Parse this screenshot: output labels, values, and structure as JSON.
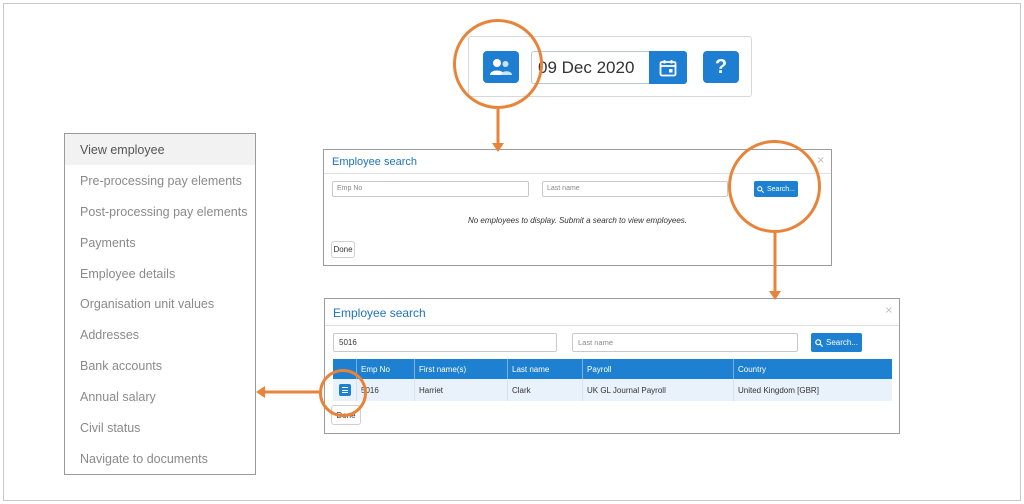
{
  "toolbar": {
    "date_value": "09 Dec 2020",
    "help_label": "?",
    "icons": [
      "employee-search-icon",
      "calendar-icon"
    ]
  },
  "menu": {
    "items": [
      "View employee",
      "Pre-processing pay elements",
      "Post-processing pay elements",
      "Payments",
      "Employee details",
      "Organisation unit values",
      "Addresses",
      "Bank accounts",
      "Annual salary",
      "Civil status",
      "Navigate to documents"
    ]
  },
  "dialog1": {
    "title": "Employee search",
    "emp_no_placeholder": "Emp No",
    "last_name_placeholder": "Last name",
    "search_label": "Search...",
    "empty_message": "No employees to display. Submit a search to view employees.",
    "done_label": "Done",
    "close_label": "×"
  },
  "dialog2": {
    "title": "Employee search",
    "emp_no_value": "5016",
    "last_name_placeholder": "Last name",
    "search_label": "Search...",
    "done_label": "Done",
    "close_label": "×",
    "columns": [
      "",
      "Emp No",
      "First name(s)",
      "Last name",
      "Payroll",
      "Country"
    ],
    "rows": [
      {
        "emp_no": "5016",
        "first_name": "Harriet",
        "last_name": "Clark",
        "payroll": "UK GL Journal Payroll",
        "country": "United Kingdom [GBR]"
      }
    ]
  },
  "colors": {
    "accent_blue": "#1e80d0",
    "annotation_orange": "#e8833a"
  }
}
